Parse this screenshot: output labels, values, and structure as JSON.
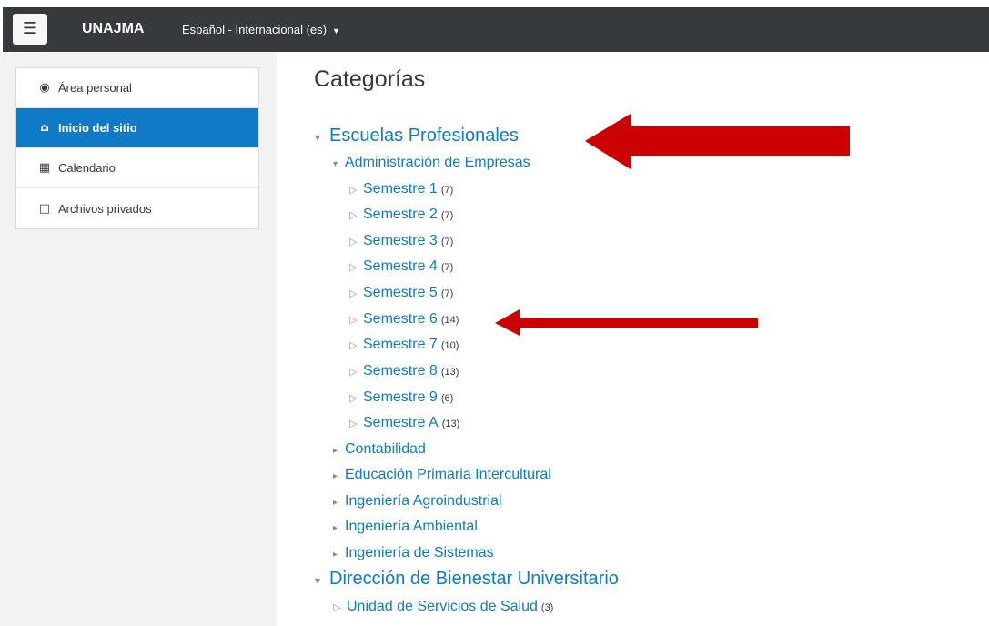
{
  "navbar": {
    "menu_icon": "hamburger-icon",
    "brand": "UNAJMA",
    "language": "Español - Internacional (es)"
  },
  "sidebar": {
    "items": [
      {
        "label": "Área personal",
        "icon": "dashboard-icon",
        "active": false
      },
      {
        "label": "Inicio del sitio",
        "icon": "home-icon",
        "active": true
      },
      {
        "label": "Calendario",
        "icon": "calendar-icon",
        "active": false
      },
      {
        "label": "Archivos privados",
        "icon": "file-icon",
        "active": false
      }
    ]
  },
  "main": {
    "title": "Categorías",
    "categories": [
      {
        "name": "Escuelas Profesionales",
        "expanded": true
      },
      {
        "name": "Administración de Empresas",
        "expanded": true
      },
      {
        "name": "Semestre 1",
        "count": "(7)"
      },
      {
        "name": "Semestre 2",
        "count": "(7)"
      },
      {
        "name": "Semestre 3",
        "count": "(7)"
      },
      {
        "name": "Semestre 4",
        "count": "(7)"
      },
      {
        "name": "Semestre 5",
        "count": "(7)"
      },
      {
        "name": "Semestre 6",
        "count": "(14)"
      },
      {
        "name": "Semestre 7",
        "count": "(10)"
      },
      {
        "name": "Semestre 8",
        "count": "(13)"
      },
      {
        "name": "Semestre 9",
        "count": "(6)"
      },
      {
        "name": "Semestre A",
        "count": "(13)"
      },
      {
        "name": "Contabilidad",
        "expanded": false
      },
      {
        "name": "Educación Primaria Intercultural",
        "expanded": false
      },
      {
        "name": "Ingeniería Agroindustrial",
        "expanded": false
      },
      {
        "name": "Ingeniería Ambiental",
        "expanded": false
      },
      {
        "name": "Ingeniería de Sistemas",
        "expanded": false
      },
      {
        "name": "Dirección de Bienestar Universitario",
        "expanded": true
      },
      {
        "name": "Unidad de Servicios de Salud",
        "count": "(3)"
      }
    ]
  },
  "colors": {
    "navbar_bg": "#373a3c",
    "accent": "#0f7ac6",
    "annotation_arrow": "#cc0000"
  }
}
